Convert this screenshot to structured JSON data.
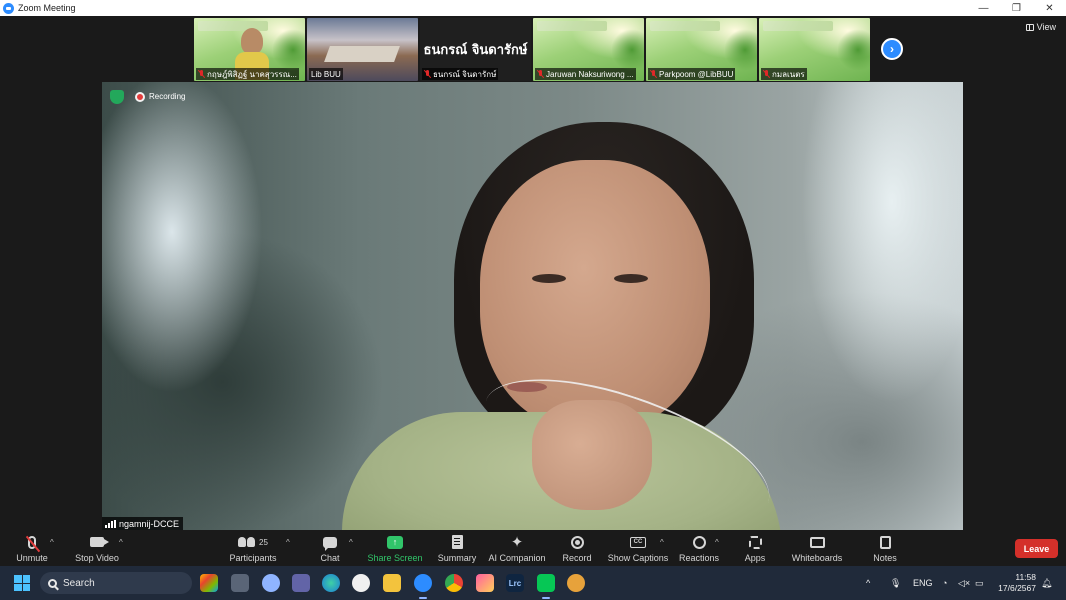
{
  "window": {
    "title": "Zoom Meeting",
    "controls": [
      "—",
      "❐",
      "✕"
    ]
  },
  "meeting": {
    "view_label": "View",
    "recording_label": "Recording",
    "main_speaker": "ngamnij-DCCE",
    "thumbnails": [
      {
        "label": "กฤษฎ์พิสิฏฐ์ นาคสุวรรณ...",
        "kind": "person"
      },
      {
        "label": "Lib BUU",
        "kind": "room"
      },
      {
        "label": "ธนกรณ์ จินดารักษ์",
        "kind": "namecard",
        "big_name": "ธนกรณ์ จินดารักษ์"
      },
      {
        "label": "Jaruwan Naksuriwong ...",
        "kind": "green"
      },
      {
        "label": "Parkpoom @LibBUU",
        "kind": "green"
      },
      {
        "label": "กมลเนตร",
        "kind": "green"
      }
    ]
  },
  "toolbar": {
    "unmute": "Unmute",
    "stop_video": "Stop Video",
    "participants": "Participants",
    "participants_count": "25",
    "chat": "Chat",
    "share_screen": "Share Screen",
    "summary": "Summary",
    "ai_companion": "AI Companion",
    "record": "Record",
    "show_captions": "Show Captions",
    "reactions": "Reactions",
    "apps": "Apps",
    "whiteboards": "Whiteboards",
    "notes": "Notes",
    "leave": "Leave",
    "cc_text": "CC"
  },
  "taskbar": {
    "search_label": "Search",
    "language": "ENG",
    "time": "11:58",
    "date": "17/6/2567",
    "lrc_label": "Lrc"
  },
  "colors": {
    "zoom_blue": "#2d8cff",
    "share_green": "#31c56a",
    "leave_red": "#d4302a",
    "taskbar": "#202a3a"
  }
}
